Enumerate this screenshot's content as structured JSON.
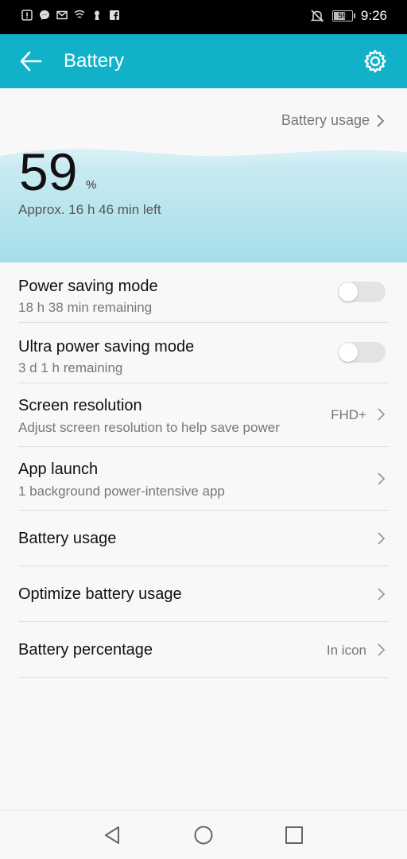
{
  "status_bar": {
    "battery_level": "59",
    "time": "9:26",
    "left_icons": [
      "alert-icon",
      "messenger-icon",
      "gmail-icon",
      "wireless-icon",
      "keyhole-icon",
      "facebook-icon"
    ],
    "right_icons": [
      "mute-icon",
      "battery-icon"
    ]
  },
  "app_bar": {
    "title": "Battery",
    "back_icon": "arrow-back-icon",
    "settings_icon": "gear-icon",
    "color": "#11b2c9"
  },
  "hero": {
    "usage_link": "Battery usage",
    "percent": "59",
    "percent_sign": "%",
    "time_left": "Approx. 16 h 46 min left"
  },
  "settings": {
    "power_saving": {
      "title": "Power saving mode",
      "subtitle": "18 h 38 min remaining",
      "enabled": false
    },
    "ultra_power_saving": {
      "title": "Ultra power saving mode",
      "subtitle": "3 d 1 h remaining",
      "enabled": false
    },
    "screen_resolution": {
      "title": "Screen resolution",
      "subtitle": "Adjust screen resolution to help save power",
      "value": "FHD+"
    },
    "app_launch": {
      "title": "App launch",
      "subtitle": "1 background power-intensive app"
    },
    "battery_usage": {
      "title": "Battery usage"
    },
    "optimize": {
      "title": "Optimize battery usage"
    },
    "battery_percentage": {
      "title": "Battery percentage",
      "value": "In icon"
    }
  },
  "nav_bar": {
    "buttons": [
      "back-triangle-icon",
      "home-circle-icon",
      "recents-square-icon"
    ]
  }
}
